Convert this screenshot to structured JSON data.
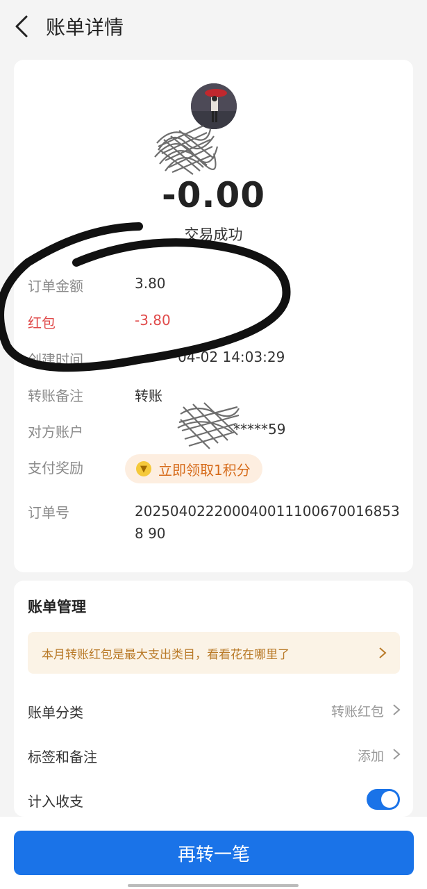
{
  "header": {
    "title": "账单详情"
  },
  "summary": {
    "amount": "-0.00",
    "status": "交易成功"
  },
  "details": [
    {
      "label": "订单金额",
      "value": "3.80"
    },
    {
      "label": "红包",
      "value": "-3.80"
    },
    {
      "label": "创建时间",
      "value": "04-02 14:03:29"
    },
    {
      "label": "转账备注",
      "value": "转账"
    },
    {
      "label": "对方账户",
      "value": "*****59"
    },
    {
      "label": "支付奖励",
      "value": "立即领取1积分"
    },
    {
      "label": "订单号",
      "value": "2025040222000400111006700168538 90"
    }
  ],
  "management": {
    "title": "账单管理",
    "tip": "本月转账红包是最大支出类目，看看花在哪里了",
    "rows": [
      {
        "label": "账单分类",
        "value": "转账红包"
      },
      {
        "label": "标签和备注",
        "value": "添加"
      },
      {
        "label": "计入收支",
        "toggle_on": true
      }
    ]
  },
  "action": {
    "primary": "再转一笔"
  },
  "colors": {
    "accent": "#1a73e8",
    "negative": "#e04a4a",
    "reward": "#d66b1a"
  },
  "icons": {
    "back": "chevron-left-icon",
    "coin": "coin-icon",
    "chevron": "chevron-right-icon"
  }
}
